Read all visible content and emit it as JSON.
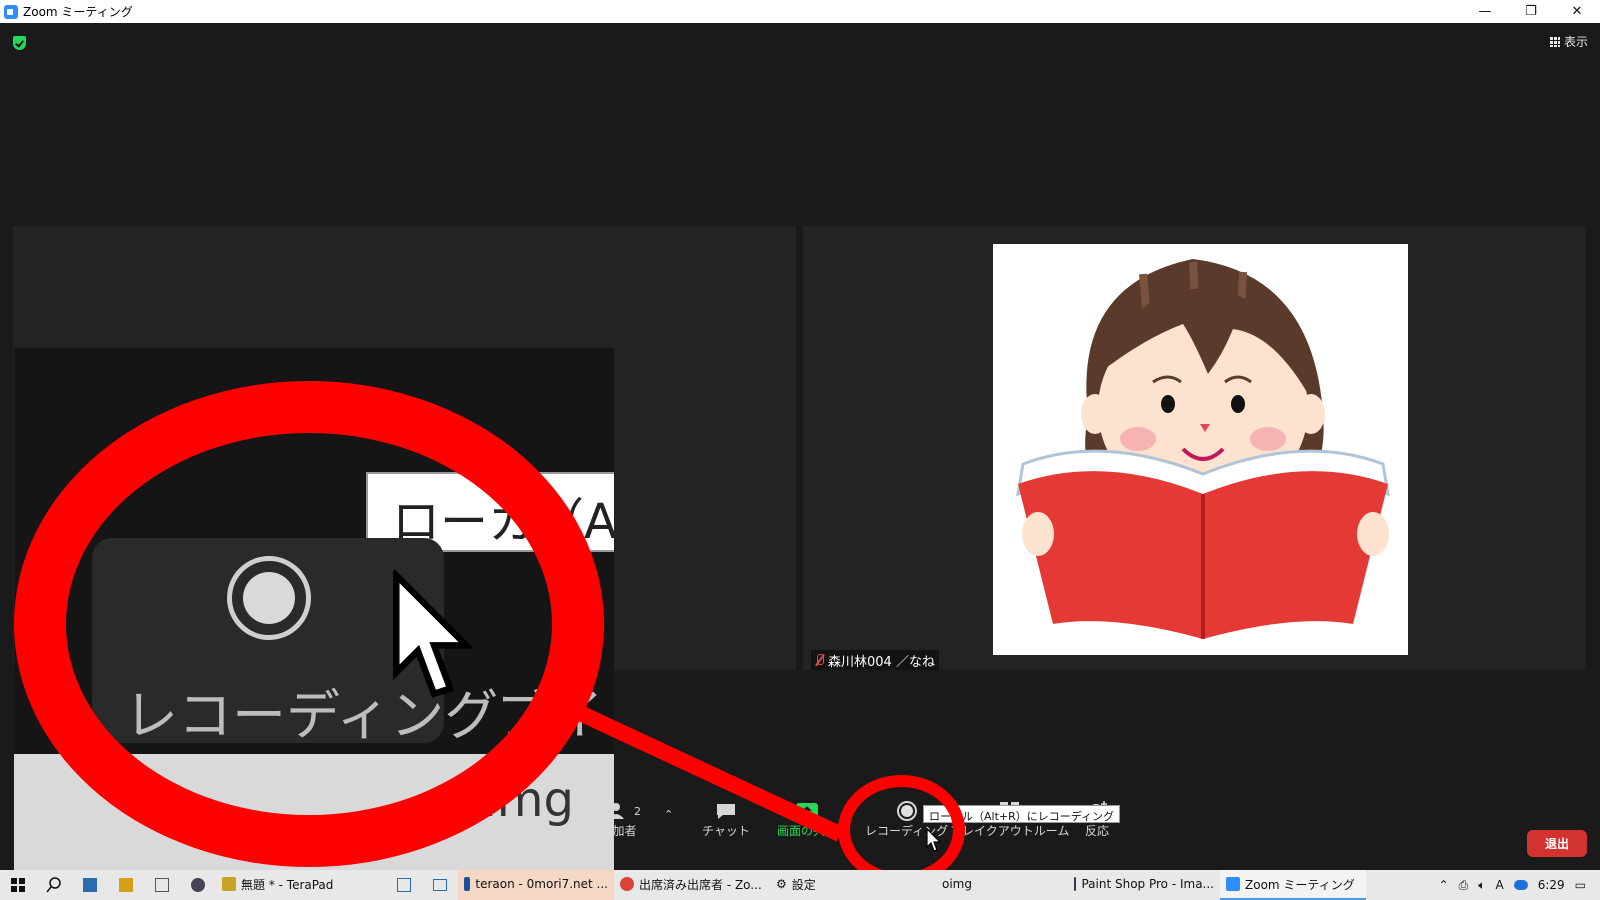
{
  "window": {
    "title": "Zoom ミーティング"
  },
  "topbar": {
    "view_label": "表示"
  },
  "participant": {
    "name": "森川林004 ／なね"
  },
  "toolbar": {
    "participants_count": "2",
    "participants_label": "加者",
    "chat_label": "チャット",
    "share_label": "画面の共有",
    "record_label": "レコーディング",
    "breakout_label": "ブレイクアウトルーム",
    "reactions_label": "反応",
    "leave_label": "退出"
  },
  "tooltip": {
    "text": "ローカル（Alt+R）にレコーディング"
  },
  "inset": {
    "tooltip_text": "ローカ（A",
    "record_label": "レコーディング",
    "next_label": "ブイ",
    "strip_text": "oimg"
  },
  "taskbar": {
    "apps": [
      {
        "label": "無題 * - TeraPad"
      },
      {
        "label": "teraon - 0mori7.net ..."
      },
      {
        "label": "出席済み出席者 - Zo..."
      },
      {
        "label": "設定"
      },
      {
        "label": "oimg"
      },
      {
        "label": "Paint Shop Pro - Ima..."
      },
      {
        "label": "Zoom ミーティング"
      }
    ],
    "time": "6:29"
  },
  "colors": {
    "accent": "#2d8cff",
    "share_green": "#23d959",
    "leave_red": "#d3332f",
    "annotation_red": "#ff0000"
  }
}
